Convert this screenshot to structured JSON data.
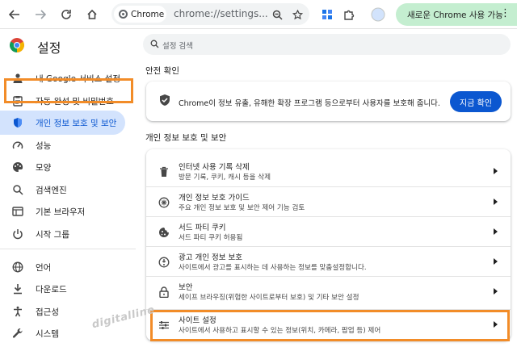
{
  "toolbar": {
    "chip_label": "Chrome",
    "url": "chrome://settings...",
    "update_button_label": "새로운 Chrome 사용 가능",
    "menu_glyph": "⋮"
  },
  "sidebar": {
    "title": "설정",
    "items": [
      {
        "label": "내 Google 서비스 설정",
        "icon": "person-icon"
      },
      {
        "label": "자동 완성 및 비밀번호",
        "icon": "clipboard-icon"
      },
      {
        "label": "개인 정보 보호 및 보안",
        "icon": "shield-icon",
        "active": true
      },
      {
        "label": "성능",
        "icon": "speedometer-icon"
      },
      {
        "label": "모양",
        "icon": "palette-icon"
      },
      {
        "label": "검색엔진",
        "icon": "search-icon"
      },
      {
        "label": "기본 브라우저",
        "icon": "browser-window-icon"
      },
      {
        "label": "시작 그룹",
        "icon": "power-icon"
      },
      {
        "label": "언어",
        "icon": "globe-icon"
      },
      {
        "label": "다운로드",
        "icon": "download-icon"
      },
      {
        "label": "접근성",
        "icon": "accessibility-icon"
      },
      {
        "label": "시스템",
        "icon": "wrench-icon"
      }
    ]
  },
  "search": {
    "placeholder": "설정 검색"
  },
  "safety_check": {
    "section_title": "안전 확인",
    "text": "Chrome이 정보 유출, 유해한 확장 프로그램 등으로부터 사용자를 보호해 줍니다.",
    "button_label": "지금 확인"
  },
  "privacy": {
    "section_title": "개인 정보 보호 및 보안",
    "rows": [
      {
        "title": "인터넷 사용 기록 삭제",
        "subtitle": "방문 기록, 쿠키, 캐시 등을 삭제",
        "icon": "trash-icon"
      },
      {
        "title": "개인 정보 보호 가이드",
        "subtitle": "주요 개인 정보 보호 및 보안 제어 기능 검토",
        "icon": "guide-plus-icon"
      },
      {
        "title": "서드 파티 쿠키",
        "subtitle": "서드 파티 쿠키 허용됨",
        "icon": "cookie-icon"
      },
      {
        "title": "광고 개인 정보 보호",
        "subtitle": "사이트에서 광고를 표시하는 데 사용하는 정보를 맞춤설정합니다.",
        "icon": "ads-icon"
      },
      {
        "title": "보안",
        "subtitle": "세이프 브라우징(위험한 사이트로부터 보호) 및 기타 보안 설정",
        "icon": "lock-icon"
      },
      {
        "title": "사이트 설정",
        "subtitle": "사이트에서 사용하고 표시할 수 있는 정보(위치, 카메라, 팝업 등) 제어",
        "icon": "sliders-icon"
      }
    ]
  },
  "watermark": "digitalline",
  "colors": {
    "accent": "#0b57d0",
    "highlight": "#f28c28",
    "active_bg": "#d3e3fd",
    "update_pill": "#c4eed0"
  }
}
